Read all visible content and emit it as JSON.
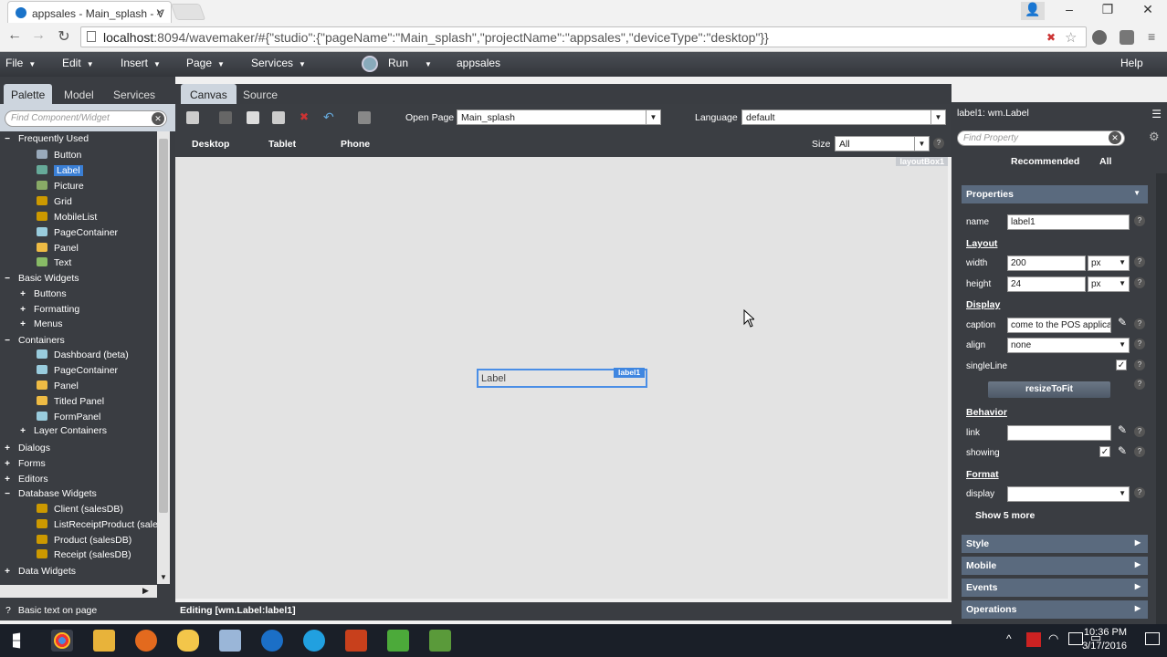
{
  "browser": {
    "tab_title": "appsales - Main_splash - V",
    "url_host": "localhost",
    "url_rest": ":8094/wavemaker/#{\"studio\":{\"pageName\":\"Main_splash\",\"projectName\":\"appsales\",\"deviceType\":\"desktop\"}}"
  },
  "menubar": {
    "items": [
      "File",
      "Edit",
      "Insert",
      "Page",
      "Services"
    ],
    "run": "Run",
    "project": "appsales",
    "help": "Help"
  },
  "left": {
    "tabs": [
      "Palette",
      "Model",
      "Services"
    ],
    "search_placeholder": "Find Component/Widget",
    "tree": [
      {
        "label": "Frequently Used",
        "level": 0,
        "expander": "−"
      },
      {
        "label": "Button",
        "level": 1,
        "icon": "#9ab"
      },
      {
        "label": "Label",
        "level": 1,
        "icon": "#6a9",
        "selected": true
      },
      {
        "label": "Picture",
        "level": 1,
        "icon": "#8a6"
      },
      {
        "label": "Grid",
        "level": 1,
        "icon": "#c90"
      },
      {
        "label": "MobileList",
        "level": 1,
        "icon": "#c90"
      },
      {
        "label": "PageContainer",
        "level": 1,
        "icon": "#9cd"
      },
      {
        "label": "Panel",
        "level": 1,
        "icon": "#eb4"
      },
      {
        "label": "Text",
        "level": 1,
        "icon": "#8b6"
      },
      {
        "label": "Basic Widgets",
        "level": 0,
        "expander": "−"
      },
      {
        "label": "Buttons",
        "level": 1,
        "expander": "+"
      },
      {
        "label": "Formatting",
        "level": 1,
        "expander": "+"
      },
      {
        "label": "Menus",
        "level": 1,
        "expander": "+"
      },
      {
        "label": "Containers",
        "level": 0,
        "expander": "−"
      },
      {
        "label": "Dashboard (beta)",
        "level": 1,
        "icon": "#9cd"
      },
      {
        "label": "PageContainer",
        "level": 1,
        "icon": "#9cd"
      },
      {
        "label": "Panel",
        "level": 1,
        "icon": "#eb4"
      },
      {
        "label": "Titled Panel",
        "level": 1,
        "icon": "#eb4"
      },
      {
        "label": "FormPanel",
        "level": 1,
        "icon": "#9cd"
      },
      {
        "label": "Layer Containers",
        "level": 1,
        "expander": "+"
      },
      {
        "label": "Dialogs",
        "level": 0,
        "expander": "+"
      },
      {
        "label": "Forms",
        "level": 0,
        "expander": "+"
      },
      {
        "label": "Editors",
        "level": 0,
        "expander": "+"
      },
      {
        "label": "Database Widgets",
        "level": 0,
        "expander": "−"
      },
      {
        "label": "Client (salesDB)",
        "level": 1,
        "icon": "#c90"
      },
      {
        "label": "ListReceiptProduct (sales",
        "level": 1,
        "icon": "#c90"
      },
      {
        "label": "Product (salesDB)",
        "level": 1,
        "icon": "#c90"
      },
      {
        "label": "Receipt (salesDB)",
        "level": 1,
        "icon": "#c90"
      },
      {
        "label": "Data Widgets",
        "level": 0,
        "expander": "+"
      }
    ],
    "status": "Basic text on page"
  },
  "center": {
    "tabs": [
      "Canvas",
      "Source"
    ],
    "open_page_label": "Open Page",
    "open_page_value": "Main_splash",
    "language_label": "Language",
    "language_value": "default",
    "devices": [
      "Desktop",
      "Tablet",
      "Phone"
    ],
    "size_label": "Size",
    "size_value": "All",
    "layout_box": "layoutBox1",
    "label_text": "Label",
    "label_tag": "label1",
    "status": "Editing [wm.Label:label1]"
  },
  "right": {
    "header": "label1: wm.Label",
    "search_placeholder": "Find Property",
    "tabs": [
      "Recommended",
      "All"
    ],
    "sections": {
      "properties": "Properties",
      "style": "Style",
      "mobile": "Mobile",
      "events": "Events",
      "operations": "Operations"
    },
    "groups": {
      "layout": "Layout",
      "display": "Display",
      "behavior": "Behavior",
      "format": "Format"
    },
    "props": {
      "name_label": "name",
      "name_value": "label1",
      "width_label": "width",
      "width_value": "200",
      "width_unit": "px",
      "height_label": "height",
      "height_value": "24",
      "height_unit": "px",
      "caption_label": "caption",
      "caption_value": "come to the POS applica",
      "align_label": "align",
      "align_value": "none",
      "singleline_label": "singleLine",
      "resize_button": "resizeToFit",
      "link_label": "link",
      "showing_label": "showing",
      "display_label": "display",
      "show_more": "Show 5 more"
    }
  },
  "taskbar": {
    "time": "10:36 PM",
    "date": "3/17/2016"
  }
}
